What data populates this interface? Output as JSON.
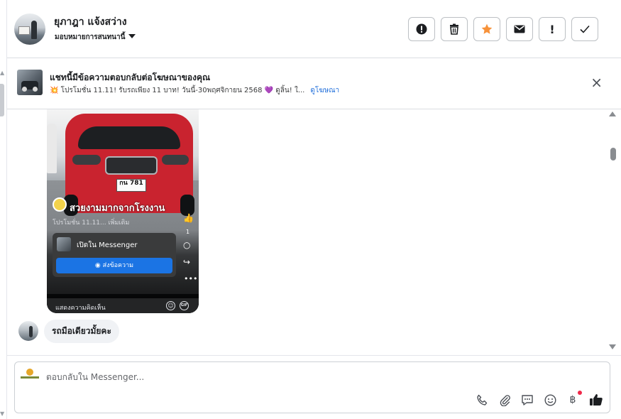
{
  "header": {
    "contact_name": "ยุภาฎา แจ้งสว่าง",
    "assign_label": "มอบหมายการสนทนานี้",
    "actions": [
      {
        "name": "report-icon",
        "label": "!"
      },
      {
        "name": "trash-icon",
        "label": "🗑"
      },
      {
        "name": "star-icon",
        "label": "★",
        "color": "#f7923a"
      },
      {
        "name": "envelope-icon",
        "label": "✉"
      },
      {
        "name": "exclamation-icon",
        "label": "!"
      },
      {
        "name": "check-icon",
        "label": "✓"
      }
    ]
  },
  "ad_banner": {
    "title": "แชทนี้มีข้อความตอบกลับต่อโฆษณาของคุณ",
    "subtitle": "💥 โปรโมชั่น 11.11! รับรถเพียง 11 บาท! วันนี้-30พฤศจิกายน 2568 💜 ดูลิ้น! ใ...",
    "link_label": "ดูโฆษณา",
    "close_icon": "×"
  },
  "reel": {
    "plate": "กน 781",
    "title": "สวยงามมากจากโรงงาน",
    "caption": "โปรโมชั่น 11.11...  เพิ่มเติม",
    "like_count": "1",
    "card_label": "เปิดใน Messenger",
    "card_button": "ส่งข้อความ",
    "comment_placeholder": "แสดงความคิดเห็น",
    "gif_label": "GIF",
    "more_label": "•••"
  },
  "messages": [
    {
      "from": "customer",
      "text": "รถมือเดียวมั้ยคะ"
    }
  ],
  "composer": {
    "placeholder": "ตอบกลับใน Messenger...",
    "tools": [
      "phone-icon",
      "paperclip-icon",
      "chat-icon",
      "emoji-icon",
      "baht-icon",
      "thumbs-up-icon"
    ]
  },
  "colors": {
    "accent": "#1b74e4",
    "star": "#f7923a",
    "link": "#216fdb",
    "notification_dot": "#f02849"
  }
}
